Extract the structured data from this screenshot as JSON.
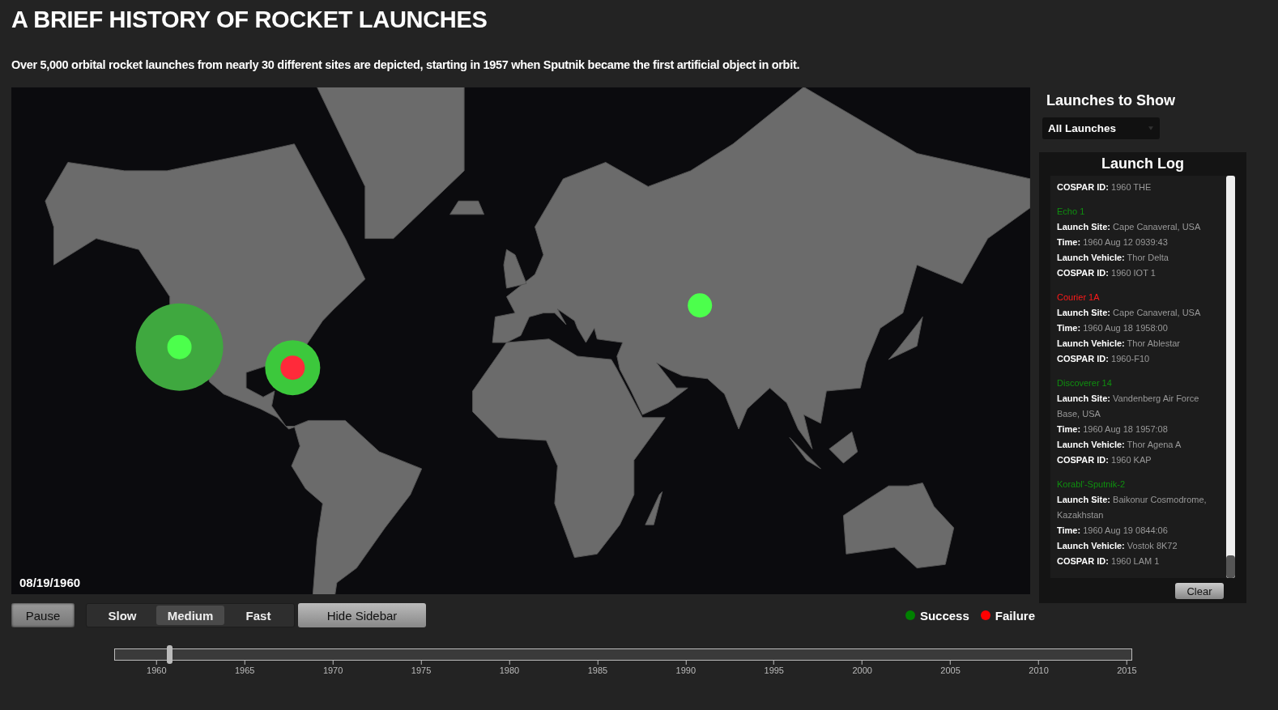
{
  "title": "A BRIEF HISTORY OF ROCKET LAUNCHES",
  "subtitle": "Over 5,000 orbital rocket launches from nearly 30 different sites are depicted, starting in 1957 when Sputnik became the first artificial object in orbit.",
  "map": {
    "date": "08/19/1960",
    "markers": [
      {
        "kind": "large-ring",
        "color": "#4cff4c"
      },
      {
        "kind": "small-ring",
        "color": "#ff2a3a"
      },
      {
        "kind": "dot",
        "color": "#4cff4c"
      }
    ]
  },
  "sidebar": {
    "filter_heading": "Launches to Show",
    "filter": {
      "value": "All Launches"
    },
    "log_heading": "Launch Log",
    "log": [
      {
        "fields": [
          {
            "label": "COSPAR ID:",
            "value": "1960 THE"
          }
        ]
      },
      {
        "name": "Echo 1",
        "color": "#0f8f0f",
        "fields": [
          {
            "label": "Launch Site:",
            "value": "Cape Canaveral, USA"
          },
          {
            "label": "Time:",
            "value": "1960 Aug 12 0939:43"
          },
          {
            "label": "Launch Vehicle:",
            "value": "Thor Delta"
          },
          {
            "label": "COSPAR ID:",
            "value": "1960 IOT 1"
          }
        ]
      },
      {
        "name": "Courier 1A",
        "color": "#ff1a1a",
        "fields": [
          {
            "label": "Launch Site:",
            "value": "Cape Canaveral, USA"
          },
          {
            "label": "Time:",
            "value": "1960 Aug 18 1958:00"
          },
          {
            "label": "Launch Vehicle:",
            "value": "Thor Ablestar"
          },
          {
            "label": "COSPAR ID:",
            "value": "1960-F10"
          }
        ]
      },
      {
        "name": "Discoverer 14",
        "color": "#0f8f0f",
        "fields": [
          {
            "label": "Launch Site:",
            "value": "Vandenberg Air Force Base, USA"
          },
          {
            "label": "Time:",
            "value": "1960 Aug 18 1957:08"
          },
          {
            "label": "Launch Vehicle:",
            "value": "Thor Agena A"
          },
          {
            "label": "COSPAR ID:",
            "value": "1960 KAP"
          }
        ]
      },
      {
        "name": "Korabl'-Sputnik-2",
        "color": "#0f8f0f",
        "fields": [
          {
            "label": "Launch Site:",
            "value": "Baikonur Cosmodrome, Kazakhstan"
          },
          {
            "label": "Time:",
            "value": "1960 Aug 19 0844:06"
          },
          {
            "label": "Launch Vehicle:",
            "value": "Vostok 8K72"
          },
          {
            "label": "COSPAR ID:",
            "value": "1960 LAM 1"
          }
        ]
      }
    ],
    "clear_button": "Clear"
  },
  "controls": {
    "pause_button": "Pause",
    "speeds": [
      {
        "label": "Slow",
        "selected": false
      },
      {
        "label": "Medium",
        "selected": true
      },
      {
        "label": "Fast",
        "selected": false
      }
    ],
    "sidebar_button": "Hide Sidebar"
  },
  "legend": [
    {
      "label": "Success",
      "color": "#008000"
    },
    {
      "label": "Failure",
      "color": "#ff0000"
    }
  ],
  "timeline": {
    "level": 0.053,
    "ticks": [
      "1960",
      "1965",
      "1970",
      "1975",
      "1980",
      "1985",
      "1990",
      "1995",
      "2000",
      "2005",
      "2010",
      "2015"
    ]
  }
}
